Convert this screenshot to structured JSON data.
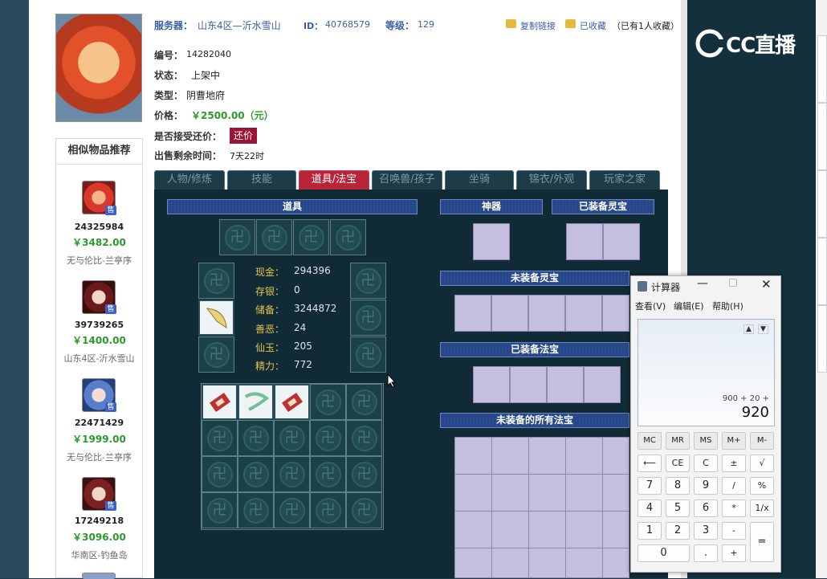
{
  "header": {
    "server_label": "服务器：",
    "server_value": "山东4区—沂水雪山",
    "id_label": "ID：",
    "id_value": "40768579",
    "level_label": "等级：",
    "level_value": "129",
    "copy_link": "复制链接",
    "collected": "已收藏",
    "collect_count": "（已有1人收藏）"
  },
  "info": {
    "number_label": "编号：",
    "number_value": "14282040",
    "status_label": "状态：",
    "status_value": "上架中",
    "type_label": "类型：",
    "type_value": "阴曹地府",
    "price_label": "价格：",
    "price_value": "￥2500.00（元）",
    "counter_label": "是否接受还价：",
    "counter_button": "还价",
    "remaining_label": "出售剩余时间：",
    "remaining_value": "7天22时"
  },
  "recommend": {
    "title": "相似物品推荐",
    "badge": "售",
    "items": [
      {
        "id": "24325984",
        "price": "￥3482.00",
        "server": "无与伦比-兰亭序"
      },
      {
        "id": "39739265",
        "price": "￥1400.00",
        "server": "山东4区-沂水雪山"
      },
      {
        "id": "22471429",
        "price": "￥1999.00",
        "server": "无与伦比-兰亭序"
      },
      {
        "id": "17249218",
        "price": "￥3096.00",
        "server": "华南区-钓鱼岛"
      }
    ]
  },
  "tabs": [
    "人物/修炼",
    "技能",
    "道具/法宝",
    "召唤兽/孩子",
    "坐骑",
    "锦衣/外观",
    "玩家之家"
  ],
  "panel": {
    "items_header": "道具",
    "artifact_header": "神器",
    "equipped_spirit_header": "已装备灵宝",
    "unequipped_spirit_header": "未装备灵宝",
    "equipped_treasure_header": "已装备法宝",
    "all_treasure_header": "未装备的所有法宝",
    "stats": [
      {
        "label": "现金：",
        "value": "294396"
      },
      {
        "label": "存银：",
        "value": "0"
      },
      {
        "label": "储备：",
        "value": "3244872"
      },
      {
        "label": "善恶：",
        "value": "24"
      },
      {
        "label": "仙玉：",
        "value": "205"
      },
      {
        "label": "精力：",
        "value": "772"
      }
    ]
  },
  "calculator": {
    "title": "计算器",
    "menu": [
      "查看(V)",
      "编辑(E)",
      "帮助(H)"
    ],
    "expression": "900 + 20 +",
    "result": "920",
    "buttons": {
      "mem": [
        "MC",
        "MR",
        "MS",
        "M+",
        "M-"
      ],
      "row1": [
        "⟵",
        "CE",
        "C",
        "±",
        "√"
      ],
      "row2": [
        "7",
        "8",
        "9",
        "/",
        "%"
      ],
      "row3": [
        "4",
        "5",
        "6",
        "*",
        "1/x"
      ],
      "row4": [
        "1",
        "2",
        "3",
        "-"
      ],
      "row5": [
        "0",
        ".",
        "+"
      ],
      "equals": "="
    }
  },
  "logo": {
    "text": "CC直播"
  }
}
